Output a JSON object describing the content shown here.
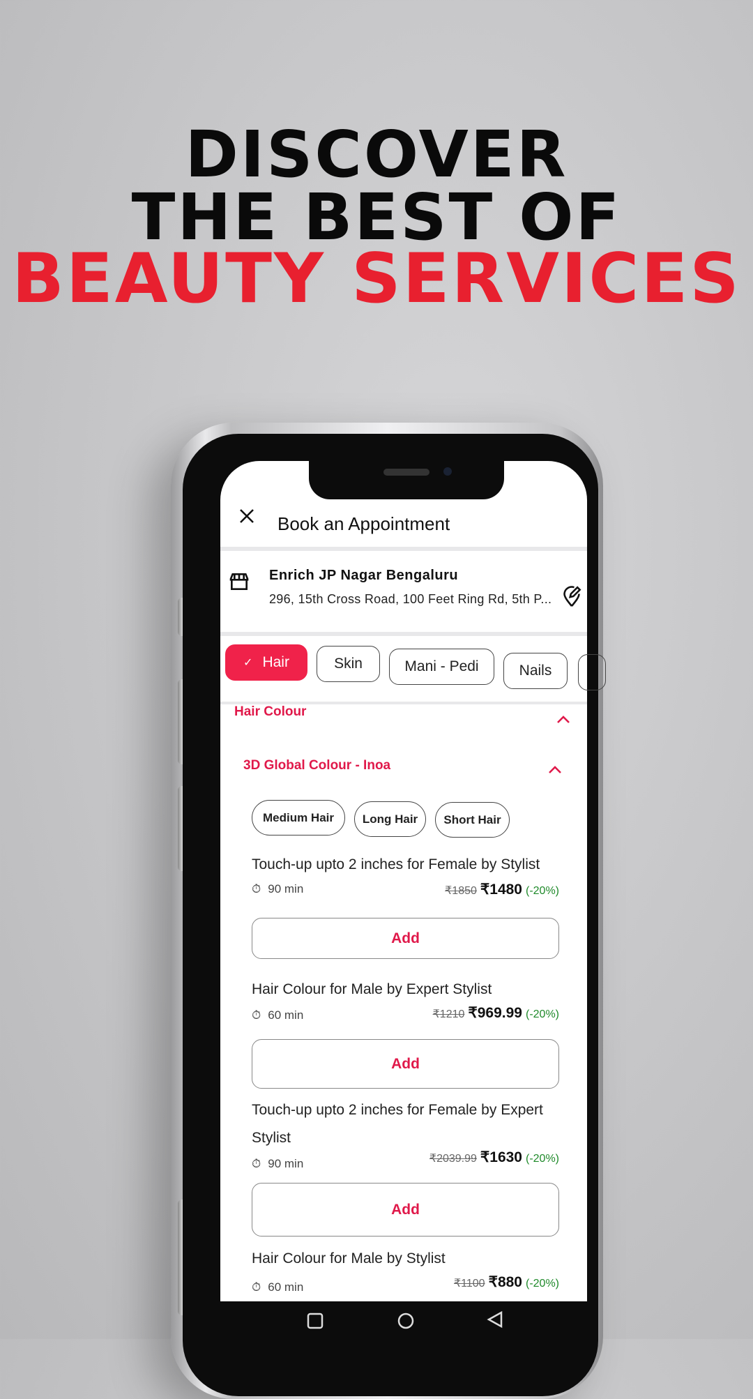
{
  "headline": {
    "line1": "DISCOVER",
    "line2": "THE BEST OF",
    "line3": "BEAUTY SERVICES",
    "accent_color": "#e8202f"
  },
  "app": {
    "title": "Book an Appointment",
    "close_icon": "close-icon",
    "salon": {
      "name": "Enrich JP Nagar Bengaluru",
      "address": "296, 15th Cross Road, 100 Feet Ring Rd, 5th P..."
    },
    "categories": [
      {
        "label": "Hair",
        "selected": true
      },
      {
        "label": "Skin"
      },
      {
        "label": "Mani - Pedi"
      },
      {
        "label": "Nails"
      }
    ],
    "section": "Hair Colour",
    "subsection": "3D Global Colour - Inoa",
    "lengths": [
      "Medium Hair",
      "Long Hair",
      "Short Hair"
    ],
    "items": [
      {
        "name": "Touch-up upto 2 inches for Female by Stylist",
        "duration": "90 min",
        "old_price": "₹1850",
        "price": "₹1480",
        "discount": "(-20%)",
        "add": "Add"
      },
      {
        "name": "Hair Colour for Male by Expert Stylist",
        "duration": "60 min",
        "old_price": "₹1210",
        "price": "₹969.99",
        "discount": "(-20%)",
        "add": "Add"
      },
      {
        "name": "Touch-up upto 2 inches for Female by Expert Stylist",
        "duration": "90 min",
        "old_price": "₹2039.99",
        "price": "₹1630",
        "discount": "(-20%)",
        "add": "Add"
      },
      {
        "name": "Hair Colour for Male by Stylist",
        "duration": "60 min",
        "old_price": "₹1100",
        "price": "₹880",
        "discount": "(-20%)"
      }
    ],
    "accent_color": "#f0224a"
  }
}
